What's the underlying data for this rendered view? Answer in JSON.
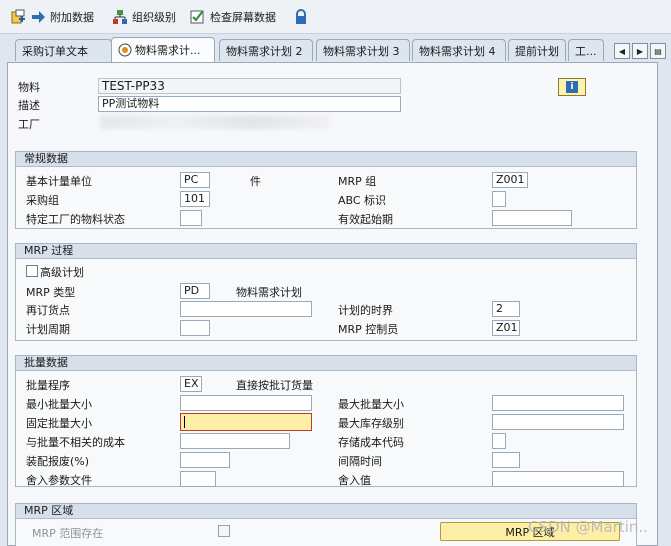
{
  "toolbar": {
    "items": [
      {
        "label": "附加数据",
        "icon": "additional-data-icon"
      },
      {
        "label": "组织级别",
        "icon": "org-levels-icon"
      },
      {
        "label": "检查屏幕数据",
        "icon": "check-screen-icon"
      }
    ],
    "lock_icon": "lock-icon"
  },
  "tabs": [
    "采购订单文本",
    "物料需求计...",
    "物料需求计划 2",
    "物料需求计划 3",
    "物料需求计划 4",
    "提前计划",
    "工..."
  ],
  "header": {
    "material_label": "物料",
    "material_value": "TEST-PP33",
    "desc_label": "描述",
    "desc_value": "PP测试物料",
    "plant_label": "工厂"
  },
  "general": {
    "title": "常规数据",
    "base_uom_label": "基本计量单位",
    "base_uom_value": "PC",
    "base_uom_text": "件",
    "mrp_group_label": "MRP 组",
    "mrp_group_value": "Z001",
    "purch_group_label": "采购组",
    "purch_group_value": "101",
    "abc_label": "ABC 标识",
    "plant_status_label": "特定工厂的物料状态",
    "valid_from_label": "有效起始期"
  },
  "mrp_proc": {
    "title": "MRP 过程",
    "adv_plan_label": "高级计划",
    "mrp_type_label": "MRP 类型",
    "mrp_type_value": "PD",
    "mrp_type_text": "物料需求计划",
    "reorder_label": "再订货点",
    "time_fence_label": "计划的时界",
    "time_fence_value": "2",
    "cycle_label": "计划周期",
    "controller_label": "MRP 控制员",
    "controller_value": "Z01"
  },
  "lot": {
    "title": "批量数据",
    "procedure_label": "批量程序",
    "procedure_value": "EX",
    "procedure_text": "直接按批订货量",
    "min_label": "最小批量大小",
    "max_label": "最大批量大小",
    "fixed_label": "固定批量大小",
    "max_stock_label": "最大库存级别",
    "ord_cost_label": "与批量不相关的成本",
    "stor_cost_label": "存储成本代码",
    "assy_scrap_label": "装配报废(%)",
    "takt_label": "间隔时间",
    "rounding_profile_label": "舍入参数文件",
    "rounding_value_label": "舍入值"
  },
  "mrp_area": {
    "title": "MRP 区域",
    "exists_label": "MRP 范围存在",
    "button_label": "MRP 区域"
  },
  "watermark": "CSDN @Martin.."
}
